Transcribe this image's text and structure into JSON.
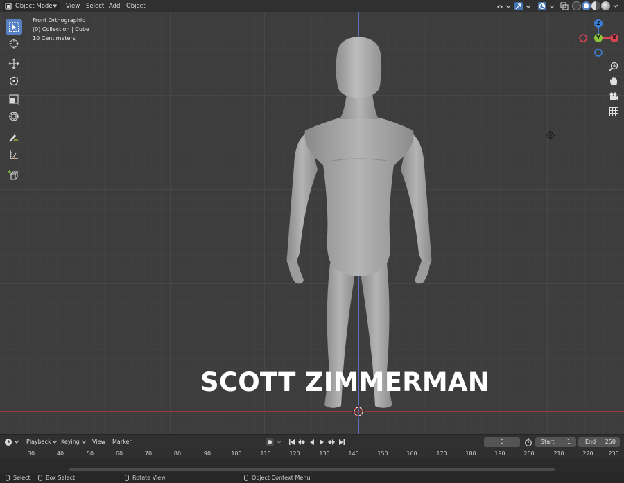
{
  "header": {
    "mode_label": "Object Mode",
    "menu": {
      "view": "View",
      "select": "Select",
      "add": "Add",
      "object": "Object"
    },
    "icons": [
      "object-mode-icon",
      "view-object-types-icon",
      "gizmo-icon",
      "overlay-icon",
      "xray-icon",
      "wireframe-shading-icon",
      "solid-shading-icon",
      "material-shading-icon",
      "rendered-shading-icon"
    ]
  },
  "viewport": {
    "info_line1": "Front Orthographic",
    "info_line2": "(0) Collection | Cube",
    "info_line3": "10 Centimeters",
    "overlay_text": "SCOTT ZIMMERMAN",
    "gizmo": {
      "z": "Z",
      "y": "Y",
      "x": "X"
    },
    "colors": {
      "x_axis": "#d94453",
      "y_axis": "#8cc43a",
      "z_axis": "#3d7fd6",
      "active_tool": "#5680c2"
    }
  },
  "toolbar": {
    "tools": [
      "select-box",
      "cursor",
      "move",
      "rotate",
      "scale",
      "transform",
      "annotate",
      "measure",
      "add-cube"
    ]
  },
  "timeline": {
    "menu": {
      "playback": "Playback",
      "keying": "Keying",
      "view": "View",
      "marker": "Marker"
    },
    "current_frame": "0",
    "start_label": "Start",
    "start_value": "1",
    "end_label": "End",
    "end_value": "250",
    "ruler_ticks": [
      "30",
      "40",
      "50",
      "60",
      "70",
      "80",
      "90",
      "100",
      "110",
      "120",
      "130",
      "140",
      "150",
      "160",
      "170",
      "180",
      "190",
      "200",
      "210",
      "220",
      "230"
    ]
  },
  "status": {
    "select": "Select",
    "box_select": "Box Select",
    "rotate_view": "Rotate View",
    "context_menu": "Object Context Menu"
  }
}
